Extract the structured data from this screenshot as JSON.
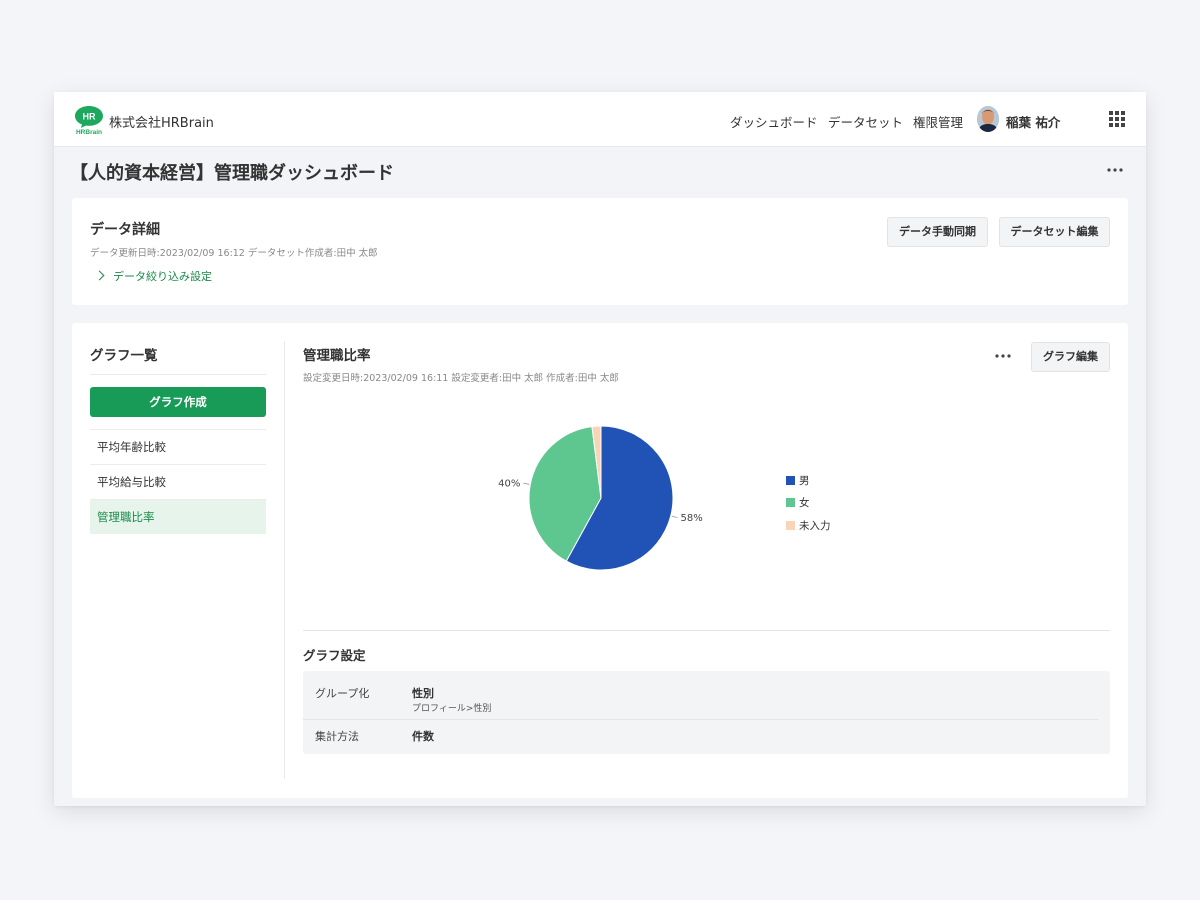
{
  "header": {
    "logo_text": "HR",
    "logo_subtext": "HRBrain",
    "company": "株式会社HRBrain",
    "nav": [
      {
        "label": "ダッシュボード"
      },
      {
        "label": "データセット"
      },
      {
        "label": "権限管理"
      }
    ],
    "user_name": "稲葉 祐介",
    "icons": {
      "apps": "grid-icon",
      "avatar": "avatar"
    }
  },
  "page": {
    "title": "【人的資本経営】管理職ダッシュボード",
    "more_icon": "more-horizontal-icon"
  },
  "data_detail": {
    "title": "データ詳細",
    "meta": "データ更新日時:2023/02/09 16:12  データセット作成者:田中 太郎",
    "filter_link": "データ絞り込み設定",
    "sync_button": "データ手動同期",
    "edit_dataset_button": "データセット編集"
  },
  "sidebar": {
    "title": "グラフ一覧",
    "create_button": "グラフ作成",
    "items": [
      {
        "label": "平均年齢比較",
        "active": false
      },
      {
        "label": "平均給与比較",
        "active": false
      },
      {
        "label": "管理職比率",
        "active": true
      }
    ]
  },
  "graph": {
    "title": "管理職比率",
    "meta": "設定変更日時:2023/02/09 16:11  設定変更者:田中 太郎  作成者:田中 太郎",
    "edit_button": "グラフ編集"
  },
  "chart_data": {
    "type": "pie",
    "categories": [
      "男",
      "女",
      "未入力"
    ],
    "values": [
      58,
      40,
      2
    ],
    "data_labels": [
      "58%",
      "40%",
      ""
    ],
    "colors": [
      "#2152b5",
      "#5ec78f",
      "#f8d5b6"
    ],
    "legend_position": "right"
  },
  "settings": {
    "title": "グラフ設定",
    "rows": [
      {
        "label": "グループ化",
        "value": "性別",
        "sub": "プロフィール>性別"
      },
      {
        "label": "集計方法",
        "value": "件数"
      }
    ]
  }
}
